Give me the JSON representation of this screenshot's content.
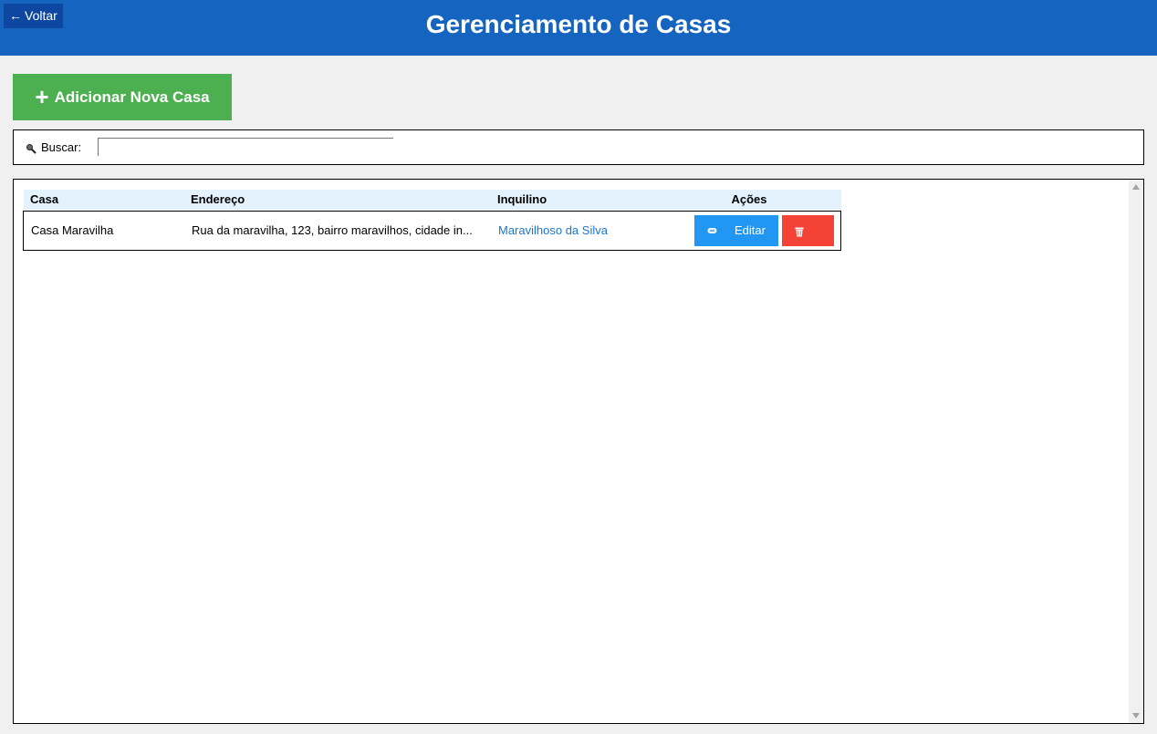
{
  "header": {
    "back_arrow": "←",
    "back_label": "Voltar",
    "title": "Gerenciamento de Casas",
    "color": "#1565c0"
  },
  "toolbar": {
    "add_icon": "+",
    "add_label": "Adicionar Nova Casa",
    "add_color": "#4caf50"
  },
  "search": {
    "icon": "magnifier-icon",
    "label": "Buscar:",
    "value": "",
    "placeholder": ""
  },
  "table": {
    "columns": [
      "Casa",
      "Endereço",
      "Inquilino",
      "Ações"
    ],
    "header_color": "#e3f2fd",
    "rows": [
      {
        "casa": "Casa Maravilha",
        "endereco": "Rua da maravilha, 123, bairro maravilhos, cidade in...",
        "inquilino": "Maravilhoso da Silva",
        "edit_icon": "pencil-icon",
        "edit_label": "Editar",
        "delete_icon": "trash-icon"
      }
    ],
    "link_color": "#1976d2",
    "edit_color": "#2196f3",
    "delete_color": "#f44336"
  }
}
